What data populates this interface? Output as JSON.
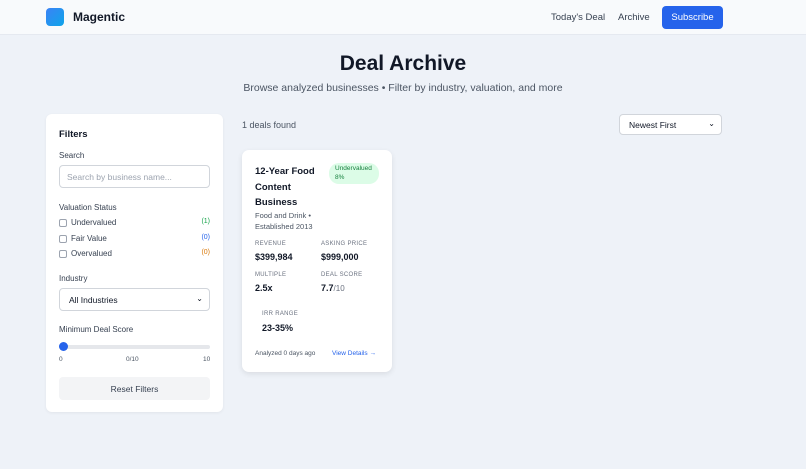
{
  "header": {
    "brand": "Magentic",
    "nav": {
      "todays_deal": "Today's Deal",
      "archive": "Archive"
    },
    "subscribe_label": "Subscribe"
  },
  "page": {
    "title": "Deal Archive",
    "subtitle": "Browse analyzed businesses • Filter by industry, valuation, and more"
  },
  "filters": {
    "title": "Filters",
    "search": {
      "label": "Search",
      "placeholder": "Search by business name...",
      "value": ""
    },
    "valuation": {
      "label": "Valuation Status",
      "options": [
        {
          "label": "Undervalued",
          "count": "(1)",
          "checked": false,
          "color": "#16a34a"
        },
        {
          "label": "Fair Value",
          "count": "(0)",
          "checked": false,
          "color": "#2563eb"
        },
        {
          "label": "Overvalued",
          "count": "(0)",
          "checked": false,
          "color": "#d97706"
        }
      ]
    },
    "industry": {
      "label": "Industry",
      "selected": "All Industries"
    },
    "min_score": {
      "label": "Minimum Deal Score",
      "min": "0",
      "current": "0/10",
      "max": "10",
      "value": 0
    },
    "reset_label": "Reset Filters"
  },
  "results": {
    "count_text": "1 deals found",
    "sort_selected": "Newest First"
  },
  "deals": [
    {
      "title": "12-Year Food Content Business",
      "badge": "Undervalued 8%",
      "industry_line": "Food and Drink • Established 2013",
      "metrics": {
        "revenue_label": "REVENUE",
        "revenue": "$399,984",
        "asking_label": "ASKING PRICE",
        "asking": "$999,000",
        "multiple_label": "MULTIPLE",
        "multiple": "2.5x",
        "score_label": "DEAL SCORE",
        "score": "7.7",
        "score_suffix": "/10",
        "irr_label": "IRR RANGE",
        "irr": "23-35%"
      },
      "analyzed": "Analyzed 0 days ago",
      "view_label": "View Details →"
    }
  ],
  "colors": {
    "accent": "#2563eb",
    "background": "#eef2f8",
    "badge_bg": "#dcfce7"
  },
  "icons": {
    "logo": "logo-mark-icon",
    "select_chevron": "chevron-down-icon",
    "checkbox": "checkbox-icon"
  }
}
